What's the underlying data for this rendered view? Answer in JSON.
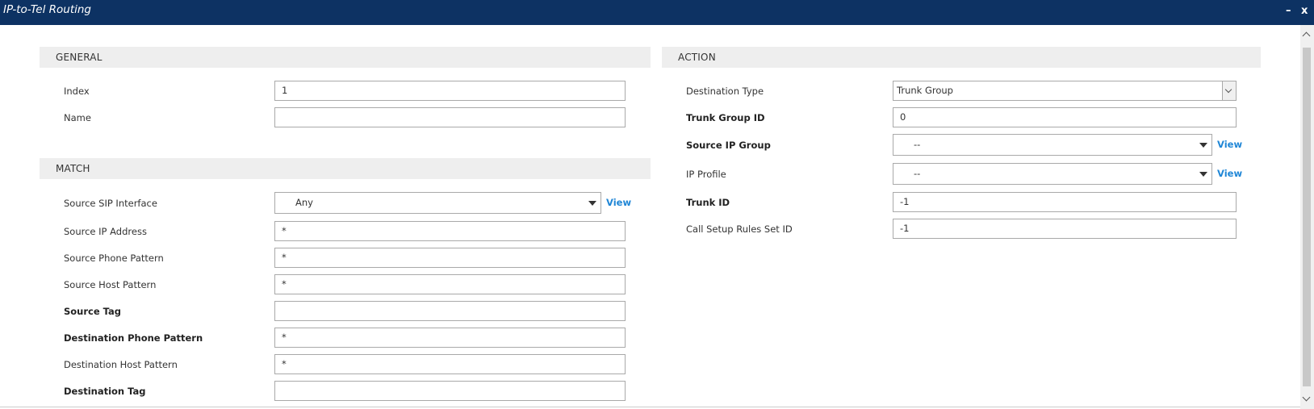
{
  "window": {
    "title": "IP-to-Tel Routing",
    "minimize_glyph": "–",
    "close_glyph": "x"
  },
  "general": {
    "header": "GENERAL",
    "fields": [
      {
        "label": "Index",
        "value": "1"
      },
      {
        "label": "Name",
        "value": ""
      }
    ]
  },
  "match": {
    "header": "MATCH",
    "source_sip_interface": {
      "label": "Source SIP Interface",
      "value": "Any",
      "view": "View"
    },
    "fields": [
      {
        "label": "Source IP Address",
        "value": "*"
      },
      {
        "label": "Source Phone Pattern",
        "value": "*"
      },
      {
        "label": "Source Host Pattern",
        "value": "*"
      },
      {
        "label": "Source Tag",
        "value": ""
      },
      {
        "label": "Destination Phone Pattern",
        "value": "*"
      },
      {
        "label": "Destination Host Pattern",
        "value": "*"
      },
      {
        "label": "Destination Tag",
        "value": ""
      }
    ]
  },
  "action": {
    "header": "ACTION",
    "destination_type": {
      "label": "Destination Type",
      "value": "Trunk Group"
    },
    "trunk_group_id": {
      "label": "Trunk Group ID",
      "value": "0"
    },
    "source_ip_group": {
      "label": "Source IP Group",
      "value": "--",
      "view": "View"
    },
    "ip_profile": {
      "label": "IP Profile",
      "value": "--",
      "view": "View"
    },
    "trunk_id": {
      "label": "Trunk ID",
      "value": "-1"
    },
    "call_setup_rules_set_id": {
      "label": "Call Setup Rules Set ID",
      "value": "-1"
    }
  },
  "colors": {
    "titlebar": "#0d3263",
    "section_header_bg": "#eeeeee",
    "link": "#1f86d6"
  }
}
